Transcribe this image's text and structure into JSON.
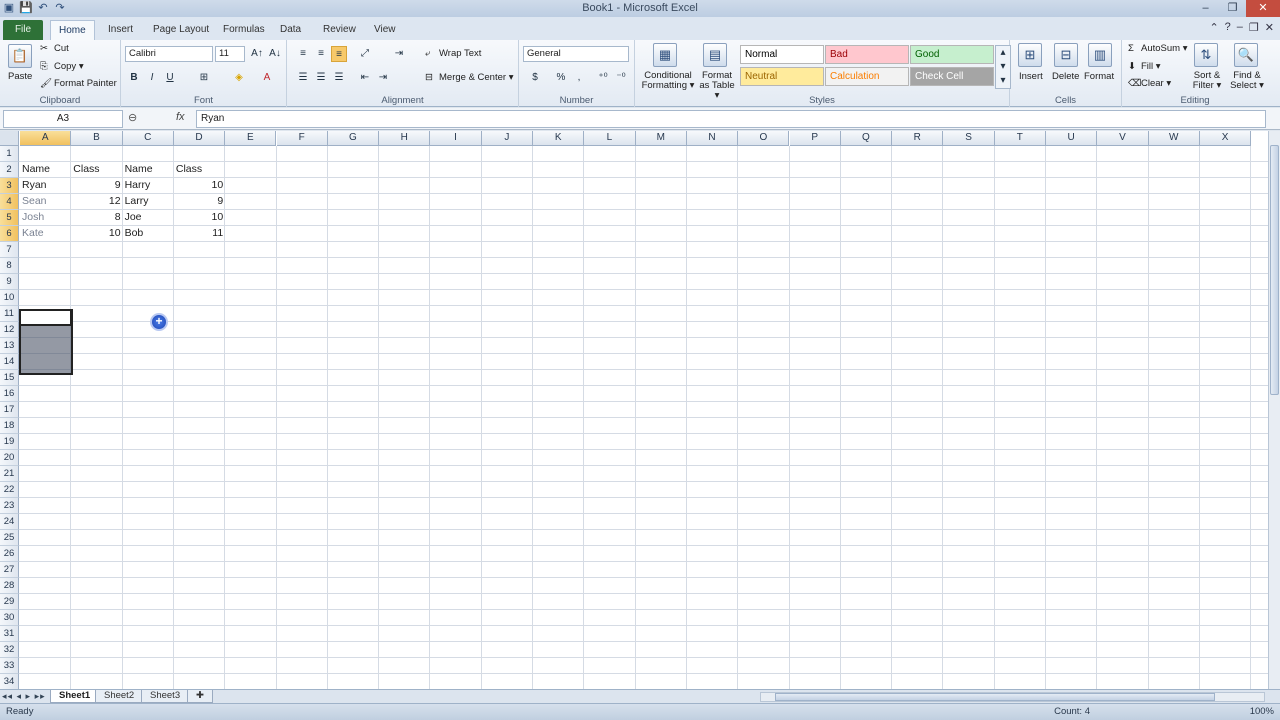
{
  "window": {
    "title": "Book1 - Microsoft Excel",
    "controls": [
      "–",
      "❐",
      "✕"
    ]
  },
  "quick_access": [
    "save-icon",
    "undo-icon",
    "redo-icon"
  ],
  "tabs": [
    {
      "label": "File",
      "active": false
    },
    {
      "label": "Home",
      "active": true
    },
    {
      "label": "Insert",
      "active": false
    },
    {
      "label": "Page Layout",
      "active": false
    },
    {
      "label": "Formulas",
      "active": false
    },
    {
      "label": "Data",
      "active": false
    },
    {
      "label": "Review",
      "active": false
    },
    {
      "label": "View",
      "active": false
    }
  ],
  "ribbon": {
    "clipboard": {
      "label": "Clipboard",
      "paste": "Paste",
      "cut": "Cut",
      "copy": "Copy ▾",
      "format_painter": "Format Painter"
    },
    "font": {
      "label": "Font",
      "name": "Calibri",
      "size": "11",
      "bold": "B",
      "italic": "I",
      "underline": "U"
    },
    "alignment": {
      "label": "Alignment",
      "wrap_text": "Wrap Text",
      "merge_center": "Merge & Center ▾"
    },
    "number": {
      "label": "Number",
      "format": "General",
      "currency": "$",
      "percent": "%",
      "comma": ","
    },
    "styles": {
      "label": "Styles",
      "conditional_formatting": "Conditional Formatting ▾",
      "format_as_table": "Format as Table ▾",
      "cells": [
        {
          "label": "Normal",
          "bg": "#ffffff",
          "fg": "#000000"
        },
        {
          "label": "Bad",
          "bg": "#ffc7ce",
          "fg": "#9c0006"
        },
        {
          "label": "Good",
          "bg": "#c6efce",
          "fg": "#006100"
        },
        {
          "label": "Neutral",
          "bg": "#ffeb9c",
          "fg": "#9c6500"
        },
        {
          "label": "Calculation",
          "bg": "#f2f2f2",
          "fg": "#fa7d00"
        },
        {
          "label": "Check Cell",
          "bg": "#a5a5a5",
          "fg": "#ffffff"
        }
      ]
    },
    "cells": {
      "label": "Cells",
      "insert": "Insert",
      "delete": "Delete",
      "format": "Format"
    },
    "editing": {
      "label": "Editing",
      "autosum": "AutoSum ▾",
      "fill": "Fill ▾",
      "clear": "Clear ▾",
      "sort_filter": "Sort & Filter ▾",
      "find_select": "Find & Select ▾"
    }
  },
  "formula_bar": {
    "name_box": "A3",
    "fx": "fx",
    "content": "Ryan"
  },
  "columns": [
    "A",
    "B",
    "C",
    "D",
    "E",
    "F",
    "G",
    "H",
    "I",
    "J",
    "K",
    "L",
    "M",
    "N",
    "O",
    "P",
    "Q",
    "R",
    "S",
    "T",
    "U",
    "V",
    "W",
    "X"
  ],
  "rows": [
    "1",
    "2",
    "3",
    "4",
    "5",
    "6",
    "7",
    "8",
    "9",
    "10",
    "11",
    "12",
    "13",
    "14",
    "15",
    "16",
    "17",
    "18",
    "19",
    "20",
    "21",
    "22",
    "23",
    "24",
    "25",
    "26",
    "27",
    "28",
    "29",
    "30",
    "31",
    "32",
    "33",
    "34"
  ],
  "selected_column": "A",
  "selected_rows": [
    "3",
    "4",
    "5",
    "6"
  ],
  "cells": {
    "A2": "Name",
    "B2": "Class",
    "C2": "Name",
    "D2": "Class",
    "A3": "Ryan",
    "B3": "9",
    "C3": "Harry",
    "D3": "10",
    "A4": "Sean",
    "B4": "12",
    "C4": "Larry",
    "D4": "9",
    "A5": "Josh",
    "B5": "8",
    "C5": "Joe",
    "D5": "10",
    "A6": "Kate",
    "B6": "10",
    "C6": "Bob",
    "D6": "11"
  },
  "sheets": [
    {
      "label": "Sheet1",
      "active": true
    },
    {
      "label": "Sheet2",
      "active": false
    },
    {
      "label": "Sheet3",
      "active": false
    }
  ],
  "status": {
    "mode": "Ready",
    "count": "Count: 4",
    "zoom": "100%"
  }
}
